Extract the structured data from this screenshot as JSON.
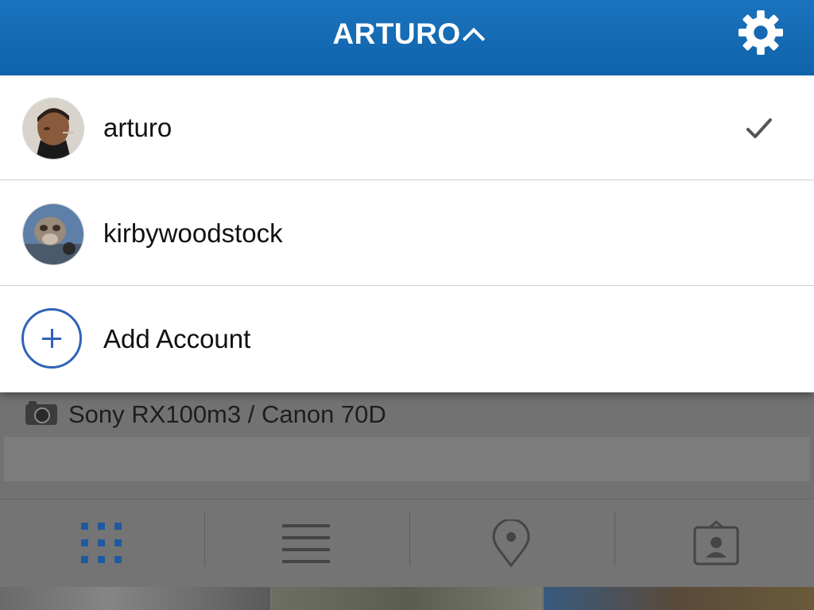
{
  "header": {
    "title": "ARTURO",
    "settings_icon": "gear-icon"
  },
  "accounts": [
    {
      "username": "arturo",
      "selected": true,
      "avatar": "avatar-arturo"
    },
    {
      "username": "kirbywoodstock",
      "selected": false,
      "avatar": "avatar-kirbywoodstock"
    }
  ],
  "add_account": {
    "label": "Add Account",
    "icon": "add-circle-icon"
  },
  "profile": {
    "bio_line": "Sony RX100m3 / Canon 70D",
    "bio_icon": "camera-icon"
  },
  "tabs": [
    {
      "name": "grid-view",
      "icon": "grid-icon",
      "active": true
    },
    {
      "name": "list-view",
      "icon": "list-icon",
      "active": false
    },
    {
      "name": "photo-map",
      "icon": "location-pin-icon",
      "active": false
    },
    {
      "name": "tagged-photos",
      "icon": "tagged-person-icon",
      "active": false
    }
  ],
  "colors": {
    "header_blue": "#1b73bd",
    "accent_blue": "#2f63b6",
    "active_tab_blue": "#1f5a9e",
    "check_gray": "#555555"
  }
}
